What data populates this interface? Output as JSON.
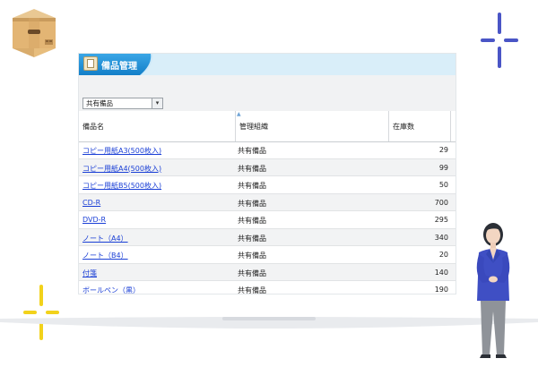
{
  "window": {
    "title": "備品管理"
  },
  "filter": {
    "selected": "共有備品"
  },
  "table": {
    "columns": [
      "備品名",
      "管理組織",
      "在庫数"
    ],
    "rows": [
      {
        "name": "コピー用紙A3(500枚入)",
        "org": "共有備品",
        "qty": "29"
      },
      {
        "name": "コピー用紙A4(500枚入)",
        "org": "共有備品",
        "qty": "99"
      },
      {
        "name": "コピー用紙B5(500枚入)",
        "org": "共有備品",
        "qty": "50"
      },
      {
        "name": "CD-R",
        "org": "共有備品",
        "qty": "700"
      },
      {
        "name": "DVD-R",
        "org": "共有備品",
        "qty": "295"
      },
      {
        "name": "ノート（A4）",
        "org": "共有備品",
        "qty": "340"
      },
      {
        "name": "ノート（B4）",
        "org": "共有備品",
        "qty": "20"
      },
      {
        "name": "付箋",
        "org": "共有備品",
        "qty": "140"
      },
      {
        "name": "ボールペン（黒）",
        "org": "共有備品",
        "qty": "190"
      }
    ]
  },
  "colors": {
    "titlebar": "#1e8fd6",
    "link": "#1a3fd6",
    "sparkle_blue": "#4a55c6",
    "sparkle_yellow": "#f2d21b"
  },
  "icons": [
    "cardboard-box-icon",
    "sparkle-icon",
    "ledger-icon",
    "dropdown-arrow-icon"
  ]
}
